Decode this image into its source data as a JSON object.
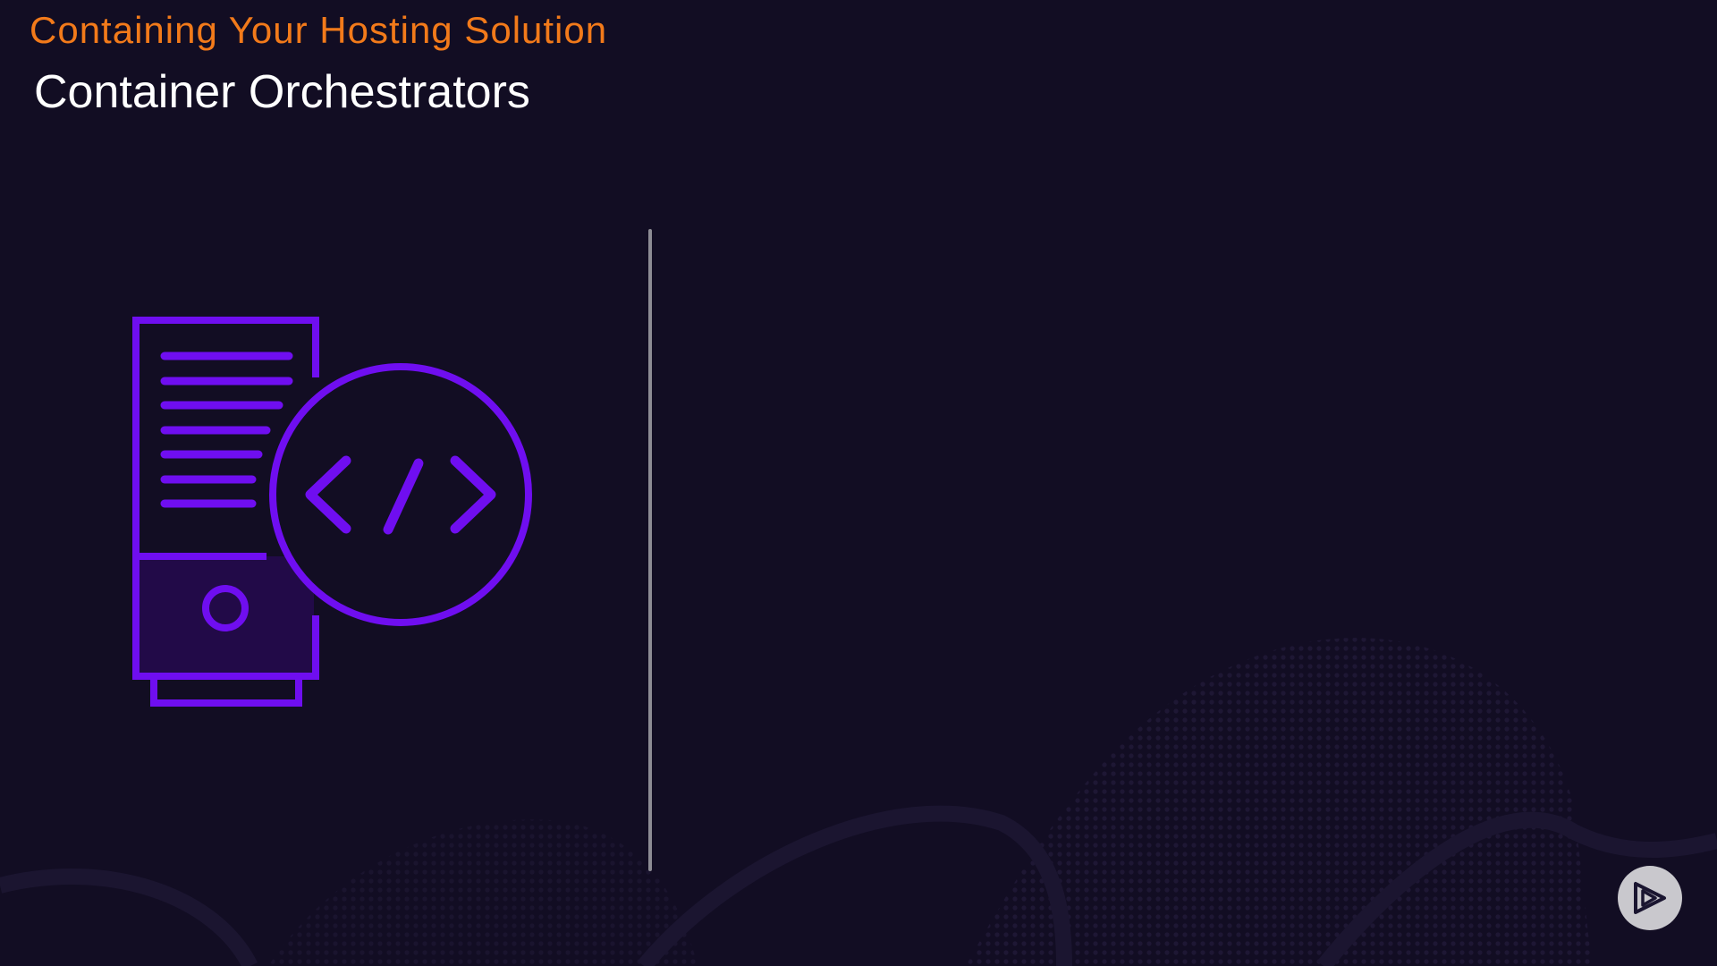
{
  "slide": {
    "subtitle": "Containing Your Hosting Solution",
    "title": "Container Orchestrators",
    "illustration_icon": "server-code-icon",
    "logo_icon": "play-logo-icon"
  },
  "colors": {
    "background": "#120d23",
    "subtitle": "#f27a1a",
    "title": "#ffffff",
    "accent": "#6f0ef0",
    "divider": "#8d8c94"
  }
}
